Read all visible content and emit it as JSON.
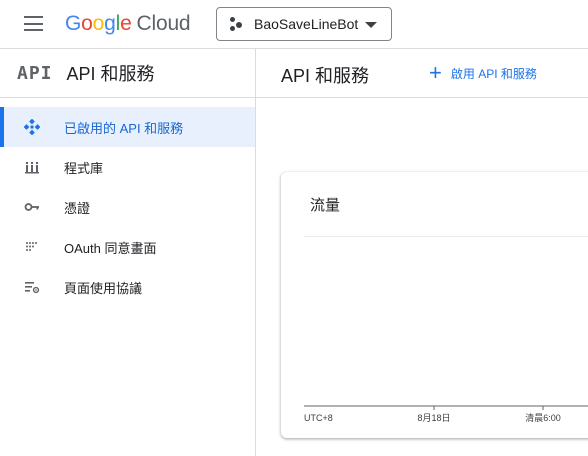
{
  "topbar": {
    "logo_letters": [
      "G",
      "o",
      "o",
      "g",
      "l",
      "e"
    ],
    "logo_suffix": "Cloud",
    "project_name": "BaoSaveLineBot"
  },
  "sidebar": {
    "badge": "API",
    "title": "API 和服務",
    "items": [
      {
        "label": "已啟用的 API 和服務",
        "icon": "api-diamond-icon",
        "active": true
      },
      {
        "label": "程式庫",
        "icon": "library-icon",
        "active": false
      },
      {
        "label": "憑證",
        "icon": "key-icon",
        "active": false
      },
      {
        "label": "OAuth 同意畫面",
        "icon": "oauth-consent-icon",
        "active": false
      },
      {
        "label": "頁面使用協議",
        "icon": "page-usage-agreement-icon",
        "active": false
      }
    ]
  },
  "main": {
    "title": "API 和服務",
    "enable_button": "啟用 API 和服務",
    "card": {
      "title": "流量"
    }
  },
  "chart_data": {
    "type": "line",
    "title": "流量",
    "x_ticks": [
      "UTC+8",
      "8月18日",
      "清晨6:00"
    ],
    "series": []
  },
  "colors": {
    "accent": "#1a73e8",
    "active_bg": "#e8f0fe"
  }
}
